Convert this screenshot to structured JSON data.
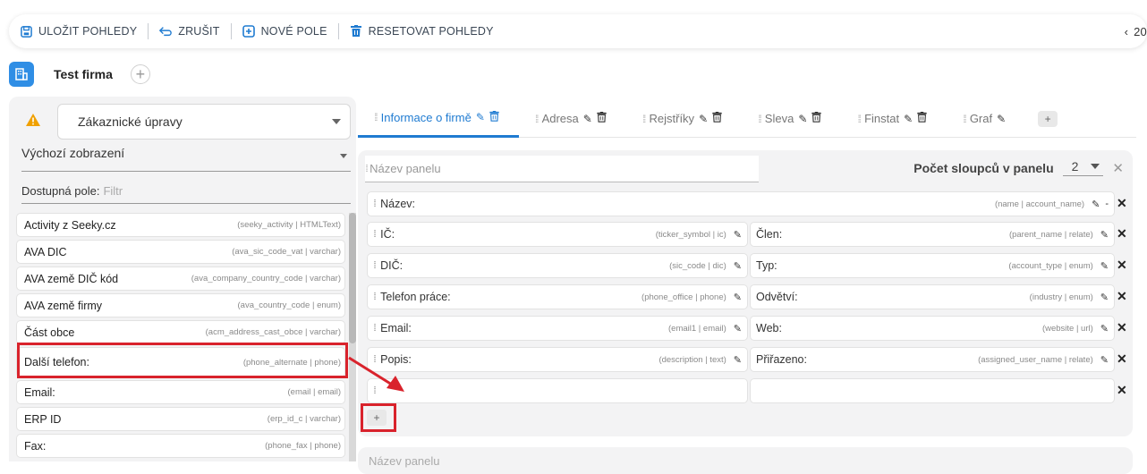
{
  "toolbar": {
    "save": "ULOŽIT POHLEDY",
    "cancel": "ZRUŠIT",
    "new_field": "NOVÉ POLE",
    "reset": "RESETOVAT POHLEDY",
    "page_number": "20"
  },
  "header": {
    "firm_name": "Test firma"
  },
  "left": {
    "customization_select": "Zákaznické úpravy",
    "view_select": "Výchozí zobrazení",
    "filter_label": "Dostupná pole:",
    "filter_placeholder": "Filtr",
    "fields": [
      {
        "label": "Activity z Seeky.cz",
        "meta": "(seeky_activity | HTMLText)"
      },
      {
        "label": "AVA DIC",
        "meta": "(ava_sic_code_vat | varchar)"
      },
      {
        "label": "AVA země DIČ kód",
        "meta": "(ava_company_country_code | varchar)"
      },
      {
        "label": "AVA země firmy",
        "meta": "(ava_country_code | enum)"
      },
      {
        "label": "Část obce",
        "meta": "(acm_address_cast_obce | varchar)"
      },
      {
        "label": "Další telefon:",
        "meta": "(phone_alternate | phone)"
      },
      {
        "label": "Email:",
        "meta": "(email | email)"
      },
      {
        "label": "ERP ID",
        "meta": "(erp_id_c | varchar)"
      },
      {
        "label": "Fax:",
        "meta": "(phone_fax | phone)"
      }
    ]
  },
  "tabs": [
    {
      "label": "Informace o firmě"
    },
    {
      "label": "Adresa"
    },
    {
      "label": "Rejstříky"
    },
    {
      "label": "Sleva"
    },
    {
      "label": "Finstat"
    },
    {
      "label": "Graf"
    }
  ],
  "panel": {
    "name_placeholder": "Název panelu",
    "cols_label": "Počet sloupců v panelu",
    "cols_value": "2",
    "rows": [
      {
        "left": {
          "label": "Název:",
          "meta": "(name | account_name)"
        }
      },
      {
        "left": {
          "label": "IČ:",
          "meta": "(ticker_symbol | ic)"
        },
        "right": {
          "label": "Člen:",
          "meta": "(parent_name | relate)"
        }
      },
      {
        "left": {
          "label": "DIČ:",
          "meta": "(sic_code | dic)"
        },
        "right": {
          "label": "Typ:",
          "meta": "(account_type | enum)"
        }
      },
      {
        "left": {
          "label": "Telefon práce:",
          "meta": "(phone_office | phone)"
        },
        "right": {
          "label": "Odvětví:",
          "meta": "(industry | enum)"
        }
      },
      {
        "left": {
          "label": "Email:",
          "meta": "(email1 | email)"
        },
        "right": {
          "label": "Web:",
          "meta": "(website | url)"
        }
      },
      {
        "left": {
          "label": "Popis:",
          "meta": "(description | text)"
        },
        "right": {
          "label": "Přiřazeno:",
          "meta": "(assigned_user_name | relate)"
        }
      }
    ]
  },
  "panel2": {
    "name_placeholder": "Název panelu"
  },
  "colors": {
    "accent": "#1f7bd1",
    "highlight": "#d9232c",
    "warning": "#f0a000"
  }
}
